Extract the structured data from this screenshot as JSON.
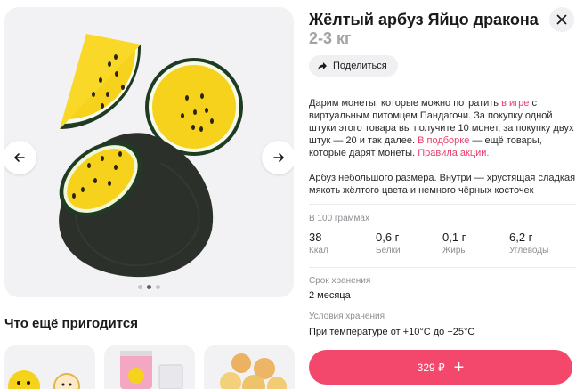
{
  "product": {
    "title": "Жёлтый арбуз Яйцо дракона",
    "weight": "2-3 кг"
  },
  "gallery": {
    "images": [
      {
        "alt": "product-image-1"
      },
      {
        "alt": "product-image-2"
      },
      {
        "alt": "product-image-3"
      }
    ],
    "active_index": 1
  },
  "actions": {
    "share_label": "Поделиться",
    "buy_label": "329 ₽",
    "buy_icon": "plus-icon"
  },
  "promo": {
    "part1": "Дарим монеты, которые можно потратить ",
    "link1": "в игре",
    "part2": " с виртуальным питомцем Пандагочи. За покупку одной штуки этого товара вы получите 10 монет, за покупку двух штук — 20 и так далее. ",
    "link2": "В подборке",
    "part3": " — ещё товары, которые дарят монеты. ",
    "link3": "Правила акции."
  },
  "description": "Арбуз небольшого размера. Внутри — хрустящая сладкая мякоть жёлтого цвета и немного чёрных косточек",
  "nutrition": {
    "header": "В 100 граммах",
    "items": [
      {
        "value": "38",
        "label": "Ккал"
      },
      {
        "value": "0,6 г",
        "label": "Белки"
      },
      {
        "value": "0,1 г",
        "label": "Жиры"
      },
      {
        "value": "6,2 г",
        "label": "Углеводы"
      }
    ]
  },
  "shelf_life": {
    "label": "Срок хранения",
    "value": "2 месяца"
  },
  "storage": {
    "label": "Условия хранения",
    "value": "При температуре от +10°С до +25°С"
  },
  "recommendations": {
    "title": "Что ещё пригодится"
  },
  "colors": {
    "accent": "#f3486c",
    "link": "#e63e6d",
    "watermelon_flesh": "#f7d21c",
    "watermelon_rind": "#2b302b"
  }
}
